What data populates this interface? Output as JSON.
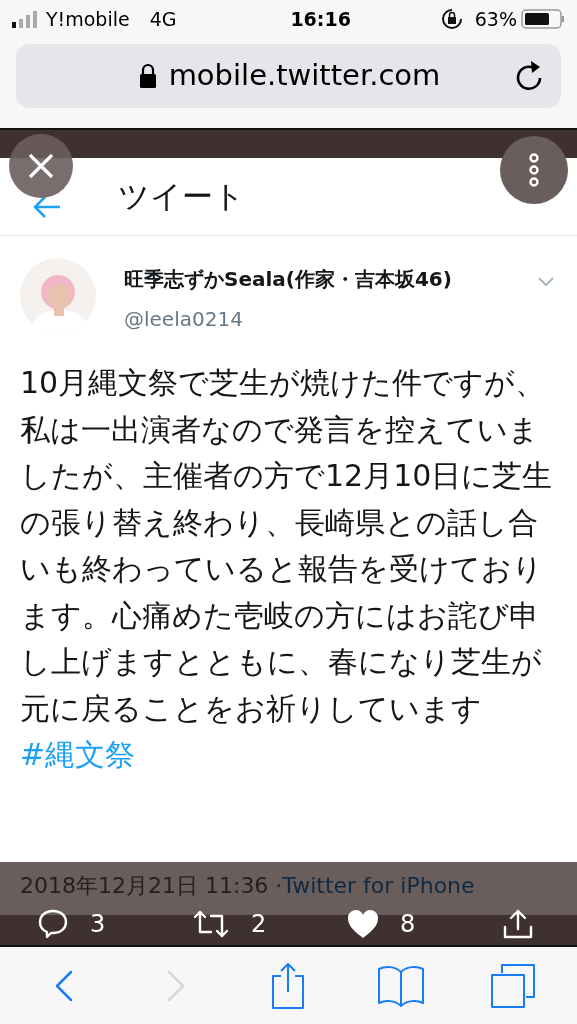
{
  "status_bar": {
    "carrier": "Y!mobile",
    "network": "4G",
    "time": "16:16",
    "battery": "63%"
  },
  "browser": {
    "url": "mobile.twitter.com"
  },
  "header": {
    "title": "ツイート"
  },
  "tweet": {
    "name": "旺季志ずかSeala(作家・吉本坂46)",
    "handle": "@leela0214",
    "text": "10月縄文祭で芝生が焼けた件ですが、私は一出演者なので発言を控えていましたが、主催者の方で12月10日に芝生の張り替え終わり、長崎県との話し合いも終わっていると報告を受けております。心痛めた壱岐の方にはお詫び申し上げますとともに、春になり芝生が元に戻ることをお祈りしています",
    "hashtag": "#縄文祭",
    "date": "2018年12月21日 11:36 · ",
    "source": "Twitter for iPhone",
    "actions": [
      {
        "kind": "reply",
        "count": "3"
      },
      {
        "kind": "retweet",
        "count": "2"
      },
      {
        "kind": "like",
        "count": "8"
      },
      {
        "kind": "share"
      }
    ]
  },
  "toolbar": [
    {
      "kind": "back",
      "disabled": false
    },
    {
      "kind": "forward",
      "disabled": true
    },
    {
      "kind": "share",
      "disabled": false
    },
    {
      "kind": "bookmarks",
      "disabled": false
    },
    {
      "kind": "tabs",
      "disabled": false
    }
  ]
}
